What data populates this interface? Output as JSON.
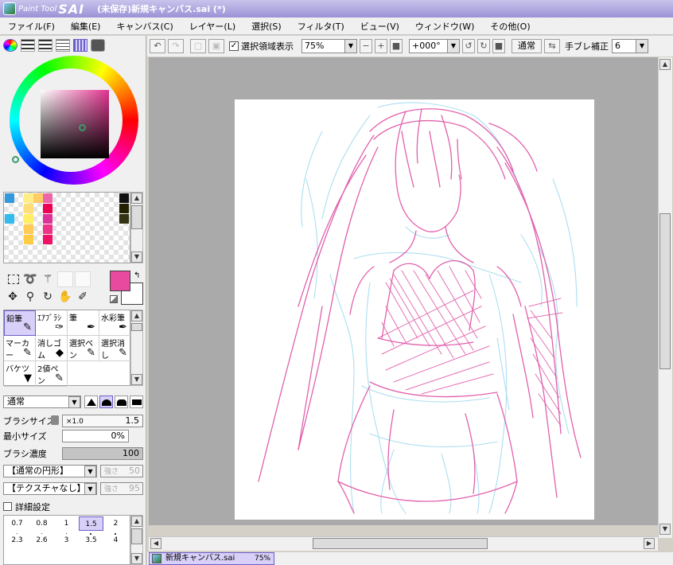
{
  "window": {
    "logo_small": "Paint Tool",
    "logo_big": "SAI",
    "title": "(未保存)新規キャンバス.sai (*)"
  },
  "menu": [
    "ファイル(F)",
    "編集(E)",
    "キャンバス(C)",
    "レイヤー(L)",
    "選択(S)",
    "フィルタ(T)",
    "ビュー(V)",
    "ウィンドウ(W)",
    "その他(O)"
  ],
  "toolbar": {
    "show_selection_label": "選択領域表示",
    "show_selection_checked": true,
    "zoom": "75%",
    "rotation": "+000°",
    "blend_label": "通常",
    "stabilizer_label": "手ブレ補正",
    "stabilizer_value": "6"
  },
  "colors": {
    "primary": "#e84a9f",
    "secondary": "#ffffff"
  },
  "swatches": [
    {
      "c": "#3399dd"
    },
    {
      "c": "#ffee88"
    },
    {
      "c": "#ffcc66"
    },
    {
      "c": "#ee66aa"
    },
    {
      "c": "#111111"
    },
    {
      "c": "#33bbee"
    },
    {
      "c": "#ffdd77"
    },
    {
      "c": "#dd3399"
    },
    {
      "c": "#222200"
    },
    {
      "c": "#ffee66"
    },
    {
      "c": "#ee3388"
    },
    {
      "c": "#333311"
    },
    {
      "c": "#ffcc55"
    },
    {
      "c": "#ee1166"
    },
    {
      "c": "#ffcc44"
    },
    {
      "c": "#ee0055"
    }
  ],
  "brushes": [
    {
      "label": "鉛筆",
      "icon": "✎"
    },
    {
      "label": "ｴｱﾌﾞﾗｼ",
      "icon": "✑"
    },
    {
      "label": "筆",
      "icon": "✒"
    },
    {
      "label": "水彩筆",
      "icon": "✒"
    },
    {
      "label": "マーカー",
      "icon": "✎"
    },
    {
      "label": "消しゴム",
      "icon": "◆"
    },
    {
      "label": "選択ペン",
      "icon": "✎"
    },
    {
      "label": "選択消し",
      "icon": "✎"
    },
    {
      "label": "バケツ",
      "icon": "▼"
    },
    {
      "label": "2値ペン",
      "icon": "✎"
    }
  ],
  "brush_settings": {
    "blend_mode": "通常",
    "size_label": "ブラシサイズ",
    "size_multiplier": "×1.0",
    "size_value": "1.5",
    "min_size_label": "最小サイズ",
    "min_size_value": "0%",
    "density_label": "ブラシ濃度",
    "density_value": "100",
    "shape": "【通常の円形】",
    "shape_strength_label": "強さ",
    "shape_strength": "50",
    "texture": "【テクスチャなし】",
    "texture_strength_label": "強さ",
    "texture_strength": "95",
    "advanced_label": "詳細設定"
  },
  "sizes": [
    "0.7",
    "0.8",
    "1",
    "1.5",
    "2",
    "2.3",
    "2.6",
    "3",
    "3.5",
    "4"
  ],
  "tab": {
    "name": "新規キャンバス.sai",
    "zoom": "75%"
  }
}
